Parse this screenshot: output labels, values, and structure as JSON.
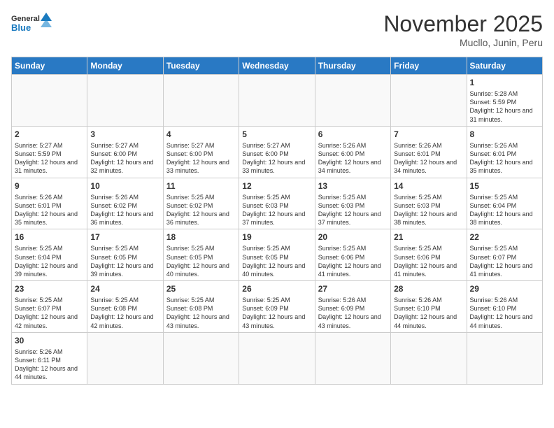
{
  "header": {
    "logo_general": "General",
    "logo_blue": "Blue",
    "month_title": "November 2025",
    "location": "Mucllo, Junin, Peru"
  },
  "weekdays": [
    "Sunday",
    "Monday",
    "Tuesday",
    "Wednesday",
    "Thursday",
    "Friday",
    "Saturday"
  ],
  "weeks": [
    [
      {
        "day": "",
        "info": ""
      },
      {
        "day": "",
        "info": ""
      },
      {
        "day": "",
        "info": ""
      },
      {
        "day": "",
        "info": ""
      },
      {
        "day": "",
        "info": ""
      },
      {
        "day": "",
        "info": ""
      },
      {
        "day": "1",
        "info": "Sunrise: 5:28 AM\nSunset: 5:59 PM\nDaylight: 12 hours and 31 minutes."
      }
    ],
    [
      {
        "day": "2",
        "info": "Sunrise: 5:27 AM\nSunset: 5:59 PM\nDaylight: 12 hours and 31 minutes."
      },
      {
        "day": "3",
        "info": "Sunrise: 5:27 AM\nSunset: 6:00 PM\nDaylight: 12 hours and 32 minutes."
      },
      {
        "day": "4",
        "info": "Sunrise: 5:27 AM\nSunset: 6:00 PM\nDaylight: 12 hours and 33 minutes."
      },
      {
        "day": "5",
        "info": "Sunrise: 5:27 AM\nSunset: 6:00 PM\nDaylight: 12 hours and 33 minutes."
      },
      {
        "day": "6",
        "info": "Sunrise: 5:26 AM\nSunset: 6:00 PM\nDaylight: 12 hours and 34 minutes."
      },
      {
        "day": "7",
        "info": "Sunrise: 5:26 AM\nSunset: 6:01 PM\nDaylight: 12 hours and 34 minutes."
      },
      {
        "day": "8",
        "info": "Sunrise: 5:26 AM\nSunset: 6:01 PM\nDaylight: 12 hours and 35 minutes."
      }
    ],
    [
      {
        "day": "9",
        "info": "Sunrise: 5:26 AM\nSunset: 6:01 PM\nDaylight: 12 hours and 35 minutes."
      },
      {
        "day": "10",
        "info": "Sunrise: 5:26 AM\nSunset: 6:02 PM\nDaylight: 12 hours and 36 minutes."
      },
      {
        "day": "11",
        "info": "Sunrise: 5:25 AM\nSunset: 6:02 PM\nDaylight: 12 hours and 36 minutes."
      },
      {
        "day": "12",
        "info": "Sunrise: 5:25 AM\nSunset: 6:03 PM\nDaylight: 12 hours and 37 minutes."
      },
      {
        "day": "13",
        "info": "Sunrise: 5:25 AM\nSunset: 6:03 PM\nDaylight: 12 hours and 37 minutes."
      },
      {
        "day": "14",
        "info": "Sunrise: 5:25 AM\nSunset: 6:03 PM\nDaylight: 12 hours and 38 minutes."
      },
      {
        "day": "15",
        "info": "Sunrise: 5:25 AM\nSunset: 6:04 PM\nDaylight: 12 hours and 38 minutes."
      }
    ],
    [
      {
        "day": "16",
        "info": "Sunrise: 5:25 AM\nSunset: 6:04 PM\nDaylight: 12 hours and 39 minutes."
      },
      {
        "day": "17",
        "info": "Sunrise: 5:25 AM\nSunset: 6:05 PM\nDaylight: 12 hours and 39 minutes."
      },
      {
        "day": "18",
        "info": "Sunrise: 5:25 AM\nSunset: 6:05 PM\nDaylight: 12 hours and 40 minutes."
      },
      {
        "day": "19",
        "info": "Sunrise: 5:25 AM\nSunset: 6:05 PM\nDaylight: 12 hours and 40 minutes."
      },
      {
        "day": "20",
        "info": "Sunrise: 5:25 AM\nSunset: 6:06 PM\nDaylight: 12 hours and 41 minutes."
      },
      {
        "day": "21",
        "info": "Sunrise: 5:25 AM\nSunset: 6:06 PM\nDaylight: 12 hours and 41 minutes."
      },
      {
        "day": "22",
        "info": "Sunrise: 5:25 AM\nSunset: 6:07 PM\nDaylight: 12 hours and 41 minutes."
      }
    ],
    [
      {
        "day": "23",
        "info": "Sunrise: 5:25 AM\nSunset: 6:07 PM\nDaylight: 12 hours and 42 minutes."
      },
      {
        "day": "24",
        "info": "Sunrise: 5:25 AM\nSunset: 6:08 PM\nDaylight: 12 hours and 42 minutes."
      },
      {
        "day": "25",
        "info": "Sunrise: 5:25 AM\nSunset: 6:08 PM\nDaylight: 12 hours and 43 minutes."
      },
      {
        "day": "26",
        "info": "Sunrise: 5:25 AM\nSunset: 6:09 PM\nDaylight: 12 hours and 43 minutes."
      },
      {
        "day": "27",
        "info": "Sunrise: 5:26 AM\nSunset: 6:09 PM\nDaylight: 12 hours and 43 minutes."
      },
      {
        "day": "28",
        "info": "Sunrise: 5:26 AM\nSunset: 6:10 PM\nDaylight: 12 hours and 44 minutes."
      },
      {
        "day": "29",
        "info": "Sunrise: 5:26 AM\nSunset: 6:10 PM\nDaylight: 12 hours and 44 minutes."
      }
    ],
    [
      {
        "day": "30",
        "info": "Sunrise: 5:26 AM\nSunset: 6:11 PM\nDaylight: 12 hours and 44 minutes."
      },
      {
        "day": "",
        "info": ""
      },
      {
        "day": "",
        "info": ""
      },
      {
        "day": "",
        "info": ""
      },
      {
        "day": "",
        "info": ""
      },
      {
        "day": "",
        "info": ""
      },
      {
        "day": "",
        "info": ""
      }
    ]
  ]
}
